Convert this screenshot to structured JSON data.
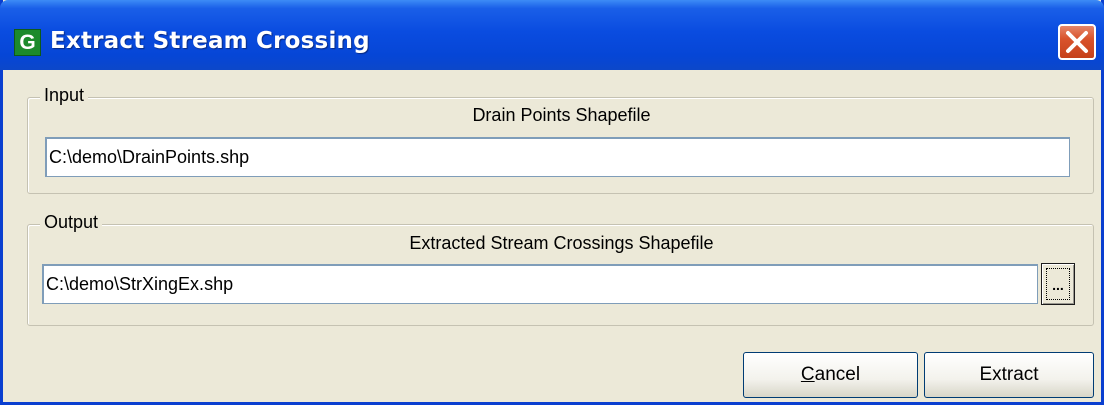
{
  "window": {
    "title": "Extract Stream Crossing",
    "app_icon_letter": "G"
  },
  "input_group": {
    "label": "Input",
    "field_caption": "Drain Points Shapefile",
    "field_value": "C:\\demo\\DrainPoints.shp"
  },
  "output_group": {
    "label": "Output",
    "field_caption": "Extracted Stream Crossings Shapefile",
    "field_value": "C:\\demo\\StrXingEx.shp",
    "browse_label": "..."
  },
  "buttons": {
    "cancel_label": "Cancel",
    "extract_label": "Extract"
  },
  "icons": {
    "app": "g-app-icon",
    "close": "close-icon"
  },
  "colors": {
    "titlebar": "#0a4ce0",
    "close_button": "#d9532c",
    "dialog_background": "#ece9d8"
  }
}
